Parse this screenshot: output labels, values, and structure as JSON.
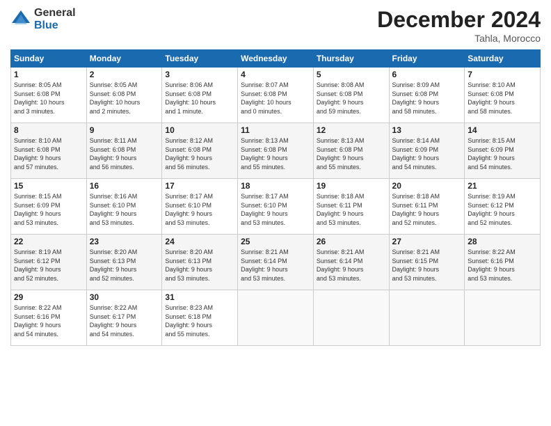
{
  "logo": {
    "general": "General",
    "blue": "Blue"
  },
  "title": "December 2024",
  "location": "Tahla, Morocco",
  "header_days": [
    "Sunday",
    "Monday",
    "Tuesday",
    "Wednesday",
    "Thursday",
    "Friday",
    "Saturday"
  ],
  "weeks": [
    [
      {
        "day": "1",
        "info": "Sunrise: 8:05 AM\nSunset: 6:08 PM\nDaylight: 10 hours\nand 3 minutes."
      },
      {
        "day": "2",
        "info": "Sunrise: 8:05 AM\nSunset: 6:08 PM\nDaylight: 10 hours\nand 2 minutes."
      },
      {
        "day": "3",
        "info": "Sunrise: 8:06 AM\nSunset: 6:08 PM\nDaylight: 10 hours\nand 1 minute."
      },
      {
        "day": "4",
        "info": "Sunrise: 8:07 AM\nSunset: 6:08 PM\nDaylight: 10 hours\nand 0 minutes."
      },
      {
        "day": "5",
        "info": "Sunrise: 8:08 AM\nSunset: 6:08 PM\nDaylight: 9 hours\nand 59 minutes."
      },
      {
        "day": "6",
        "info": "Sunrise: 8:09 AM\nSunset: 6:08 PM\nDaylight: 9 hours\nand 58 minutes."
      },
      {
        "day": "7",
        "info": "Sunrise: 8:10 AM\nSunset: 6:08 PM\nDaylight: 9 hours\nand 58 minutes."
      }
    ],
    [
      {
        "day": "8",
        "info": "Sunrise: 8:10 AM\nSunset: 6:08 PM\nDaylight: 9 hours\nand 57 minutes."
      },
      {
        "day": "9",
        "info": "Sunrise: 8:11 AM\nSunset: 6:08 PM\nDaylight: 9 hours\nand 56 minutes."
      },
      {
        "day": "10",
        "info": "Sunrise: 8:12 AM\nSunset: 6:08 PM\nDaylight: 9 hours\nand 56 minutes."
      },
      {
        "day": "11",
        "info": "Sunrise: 8:13 AM\nSunset: 6:08 PM\nDaylight: 9 hours\nand 55 minutes."
      },
      {
        "day": "12",
        "info": "Sunrise: 8:13 AM\nSunset: 6:08 PM\nDaylight: 9 hours\nand 55 minutes."
      },
      {
        "day": "13",
        "info": "Sunrise: 8:14 AM\nSunset: 6:09 PM\nDaylight: 9 hours\nand 54 minutes."
      },
      {
        "day": "14",
        "info": "Sunrise: 8:15 AM\nSunset: 6:09 PM\nDaylight: 9 hours\nand 54 minutes."
      }
    ],
    [
      {
        "day": "15",
        "info": "Sunrise: 8:15 AM\nSunset: 6:09 PM\nDaylight: 9 hours\nand 53 minutes."
      },
      {
        "day": "16",
        "info": "Sunrise: 8:16 AM\nSunset: 6:10 PM\nDaylight: 9 hours\nand 53 minutes."
      },
      {
        "day": "17",
        "info": "Sunrise: 8:17 AM\nSunset: 6:10 PM\nDaylight: 9 hours\nand 53 minutes."
      },
      {
        "day": "18",
        "info": "Sunrise: 8:17 AM\nSunset: 6:10 PM\nDaylight: 9 hours\nand 53 minutes."
      },
      {
        "day": "19",
        "info": "Sunrise: 8:18 AM\nSunset: 6:11 PM\nDaylight: 9 hours\nand 53 minutes."
      },
      {
        "day": "20",
        "info": "Sunrise: 8:18 AM\nSunset: 6:11 PM\nDaylight: 9 hours\nand 52 minutes."
      },
      {
        "day": "21",
        "info": "Sunrise: 8:19 AM\nSunset: 6:12 PM\nDaylight: 9 hours\nand 52 minutes."
      }
    ],
    [
      {
        "day": "22",
        "info": "Sunrise: 8:19 AM\nSunset: 6:12 PM\nDaylight: 9 hours\nand 52 minutes."
      },
      {
        "day": "23",
        "info": "Sunrise: 8:20 AM\nSunset: 6:13 PM\nDaylight: 9 hours\nand 52 minutes."
      },
      {
        "day": "24",
        "info": "Sunrise: 8:20 AM\nSunset: 6:13 PM\nDaylight: 9 hours\nand 53 minutes."
      },
      {
        "day": "25",
        "info": "Sunrise: 8:21 AM\nSunset: 6:14 PM\nDaylight: 9 hours\nand 53 minutes."
      },
      {
        "day": "26",
        "info": "Sunrise: 8:21 AM\nSunset: 6:14 PM\nDaylight: 9 hours\nand 53 minutes."
      },
      {
        "day": "27",
        "info": "Sunrise: 8:21 AM\nSunset: 6:15 PM\nDaylight: 9 hours\nand 53 minutes."
      },
      {
        "day": "28",
        "info": "Sunrise: 8:22 AM\nSunset: 6:16 PM\nDaylight: 9 hours\nand 53 minutes."
      }
    ],
    [
      {
        "day": "29",
        "info": "Sunrise: 8:22 AM\nSunset: 6:16 PM\nDaylight: 9 hours\nand 54 minutes."
      },
      {
        "day": "30",
        "info": "Sunrise: 8:22 AM\nSunset: 6:17 PM\nDaylight: 9 hours\nand 54 minutes."
      },
      {
        "day": "31",
        "info": "Sunrise: 8:23 AM\nSunset: 6:18 PM\nDaylight: 9 hours\nand 55 minutes."
      },
      {
        "day": "",
        "info": ""
      },
      {
        "day": "",
        "info": ""
      },
      {
        "day": "",
        "info": ""
      },
      {
        "day": "",
        "info": ""
      }
    ]
  ]
}
